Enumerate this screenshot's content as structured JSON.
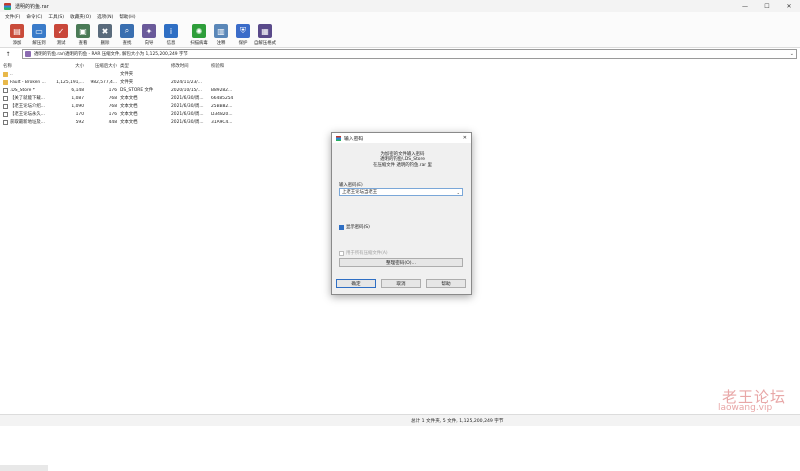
{
  "window": {
    "title": "透明的钓鱼.rar",
    "controls": {
      "minimize": "—",
      "maximize": "☐",
      "close": "✕"
    }
  },
  "menu": [
    "文件(F)",
    "命令(C)",
    "工具(S)",
    "收藏夹(O)",
    "选项(N)",
    "帮助(H)"
  ],
  "toolbar": [
    {
      "label": "添加",
      "icon": "add-archive-icon",
      "color": "#c94b3a"
    },
    {
      "label": "解压到",
      "icon": "extract-to-icon",
      "color": "#3a7bc9"
    },
    {
      "label": "测试",
      "icon": "test-icon",
      "color": "#c9473a"
    },
    {
      "label": "查看",
      "icon": "view-icon",
      "color": "#4a7a56"
    },
    {
      "label": "删除",
      "icon": "delete-icon",
      "color": "#5a6b7c"
    },
    {
      "label": "查找",
      "icon": "find-icon",
      "color": "#3a6fb0"
    },
    {
      "label": "向导",
      "icon": "wizard-icon",
      "color": "#6a5a9a"
    },
    {
      "label": "信息",
      "icon": "info-icon",
      "color": "#2f6fc4"
    },
    {
      "label": "扫描病毒",
      "icon": "virus-scan-icon",
      "color": "#2e9e3a"
    },
    {
      "label": "注释",
      "icon": "comment-icon",
      "color": "#5a87b8"
    },
    {
      "label": "保护",
      "icon": "protect-icon",
      "color": "#3b6cc9"
    },
    {
      "label": "自解压格式",
      "icon": "sfx-icon",
      "color": "#5a4a8a"
    }
  ],
  "address": {
    "up": "↑",
    "path": "透明的钓鱼.rar\\透明的钓鱼 - RAR 压缩文件, 解包大小为 1,125,200,249 字节",
    "arrow": "⌄"
  },
  "list": {
    "columns": [
      "名称",
      "大小",
      "压缩后大小",
      "类型",
      "修改时间",
      "校验和"
    ],
    "rows": [
      {
        "icon": "folder",
        "name": "..",
        "size": "",
        "packed": "",
        "type": "文件夹",
        "modified": "",
        "crc": ""
      },
      {
        "icon": "folder",
        "name": "Fault - Broken ...",
        "size": "1,125,191,...",
        "packed": "982,577,4...",
        "type": "文件夹",
        "modified": "2024/11/23/...",
        "crc": ""
      },
      {
        "icon": "file",
        "name": ".DS_Store *",
        "size": "6,148",
        "packed": "176",
        "type": "DS_STORE 文件",
        "modified": "2020/10/15/...",
        "crc": "B89282..."
      },
      {
        "icon": "file",
        "name": "【关了就能下载...",
        "size": "1,087",
        "packed": "768",
        "type": "文本文档",
        "modified": "2021/6/30/周...",
        "crc": "66485254"
      },
      {
        "icon": "file",
        "name": "【老王论坛介绍...",
        "size": "1,090",
        "packed": "768",
        "type": "文本文档",
        "modified": "2021/6/30/周...",
        "crc": "25BB82..."
      },
      {
        "icon": "file",
        "name": "【老王论坛永久...",
        "size": "170",
        "packed": "176",
        "type": "文本文档",
        "modified": "2021/6/30/周...",
        "crc": "D34820..."
      },
      {
        "icon": "file",
        "name": "获取最新地址及...",
        "size": "592",
        "packed": "448",
        "type": "文本文档",
        "modified": "2021/6/30/周...",
        "crc": "31A9C4..."
      }
    ]
  },
  "status": {
    "text": "总计 1 文件夹, 5 文件, 1,125,200,249 字节"
  },
  "dialog": {
    "title": "输入密码",
    "close": "✕",
    "info_lines": [
      "为加密的文件输入密码",
      "透明的钓鱼\\.DS_Store",
      "在压缩文件 透明的钓鱼.rar 里"
    ],
    "password_label": "输入密码(E)",
    "password_value": "上老王论坛当老王",
    "dropdown_arrow": "⌄",
    "show_password": "显示密码(S)",
    "use_for_all": "用于所有压缩文件(A)",
    "organize": "整理密码(O)...",
    "ok": "确定",
    "cancel": "取消",
    "help": "帮助"
  },
  "watermark": {
    "line1": "老王论坛",
    "line2": "laowang.vip"
  }
}
